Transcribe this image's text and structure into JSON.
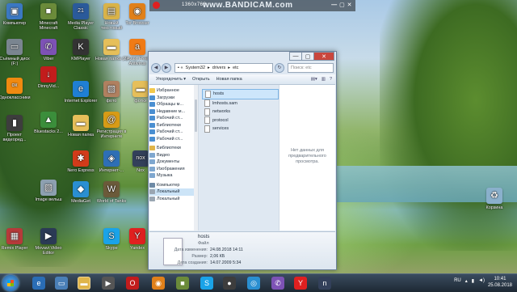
{
  "recorder": {
    "resolution": "1360x768",
    "brand": "www.BANDICAM.com"
  },
  "desktop_icons": [
    {
      "label": "Компьютер",
      "icon": "computer-icon",
      "color": "#3b78c2",
      "glyph": "▣"
    },
    {
      "label": "Minecraft Minecraft",
      "icon": "minecraft-icon",
      "color": "#6b8b3a",
      "glyph": "■"
    },
    {
      "label": "Media Player Classic",
      "icon": "media-player-icon",
      "color": "#2a5a9a",
      "glyph": "21"
    },
    {
      "label": "Новый текстовый",
      "icon": "text-document-icon",
      "color": "#d9b34a",
      "glyph": "▤"
    },
    {
      "label": "Tor Browser",
      "icon": "tor-browser-icon",
      "color": "#e0801a",
      "glyph": "◉"
    },
    {
      "label": "Съёмный диск (F:)",
      "icon": "removable-disk-icon",
      "color": "#7a8590",
      "glyph": "▭"
    },
    {
      "label": "Viber",
      "icon": "viber-icon",
      "color": "#7d52b5",
      "glyph": "✆"
    },
    {
      "label": "KMPlayer",
      "icon": "kmplayer-icon",
      "color": "#333",
      "glyph": "K"
    },
    {
      "label": "Новая папка (2)",
      "icon": "folder-icon",
      "color": "#e6bf5a",
      "glyph": "▬"
    },
    {
      "label": "Avast Free Antivirus",
      "icon": "avast-icon",
      "color": "#f07b16",
      "glyph": "a"
    },
    {
      "label": "Одноклассники",
      "icon": "odnoklassniki-icon",
      "color": "#f08a10",
      "glyph": "ок"
    },
    {
      "label": "DinnyVid...",
      "icon": "downloader-icon",
      "color": "#c21c1c",
      "glyph": "↓"
    },
    {
      "label": "Internet Explorer",
      "icon": "internet-explorer-icon",
      "color": "#1f7fd4",
      "glyph": "e"
    },
    {
      "label": "фото",
      "icon": "photo-icon",
      "color": "#b08060",
      "glyph": "▧"
    },
    {
      "label": "фотки",
      "icon": "folder-icon",
      "color": "#e6bf5a",
      "glyph": "▬"
    },
    {
      "label": "Bluestacks 2...",
      "icon": "bluestacks-icon",
      "color": "#3b8e3b",
      "glyph": "▲"
    },
    {
      "label": "Проект видеоред...",
      "icon": "video-project-icon",
      "color": "#3d3d3d",
      "glyph": "▮"
    },
    {
      "label": "Новая папка",
      "icon": "folder-icon",
      "color": "#e6bf5a",
      "glyph": "▬"
    },
    {
      "label": "Регистрация в Интернете",
      "icon": "registration-icon",
      "color": "#d79b16",
      "glyph": "@"
    },
    {
      "label": "Nero Express",
      "icon": "nero-icon",
      "color": "#d23b1a",
      "glyph": "✱"
    },
    {
      "label": "Интернет-...",
      "icon": "internet-icon",
      "color": "#2e6fb5",
      "glyph": "◈"
    },
    {
      "label": "Nox",
      "icon": "nox-icon",
      "color": "#33405a",
      "glyph": "nox"
    },
    {
      "label": "MediaGet",
      "icon": "mediaget-icon",
      "color": "#2a8fd1",
      "glyph": "◆"
    },
    {
      "label": "World of Tanks",
      "icon": "world-of-tanks-icon",
      "color": "#6b5a3a",
      "glyph": "W"
    },
    {
      "label": "Image вельш",
      "icon": "image-icon",
      "color": "#8da0b0",
      "glyph": "▧"
    },
    {
      "label": "Корзина",
      "icon": "recycle-bin-icon",
      "color": "#8ab0cc",
      "glyph": "♻"
    },
    {
      "label": "Remix Player",
      "icon": "remix-icon",
      "color": "#b53a3a",
      "glyph": "▦"
    },
    {
      "label": "Movavi Video Editor",
      "icon": "movavi-icon",
      "color": "#2b3a55",
      "glyph": "▶"
    },
    {
      "label": "Skype",
      "icon": "skype-icon",
      "color": "#1aa3e8",
      "glyph": "S"
    },
    {
      "label": "Yandex",
      "icon": "yandex-icon",
      "color": "#e02020",
      "glyph": "Y"
    }
  ],
  "explorer": {
    "path": [
      "System32",
      "drivers",
      "etc"
    ],
    "search_placeholder": "Поиск: etc",
    "toolbar": {
      "organize": "Упорядочить ▾",
      "open": "Открыть",
      "new_folder": "Новая папка"
    },
    "nav": {
      "favorites_header": "Избранное",
      "favorites": [
        "Загрузки",
        "Образцы м...",
        "Недавние м...",
        "Рабочий ст...",
        "Библиотеки",
        "Рабочий ст...",
        "Рабочий ст..."
      ],
      "libraries_header": "Библиотеки",
      "libraries": [
        "Видео",
        "Документы",
        "Изображения",
        "Музыка"
      ],
      "computer_header": "Компьютер",
      "drives": [
        "Локальный",
        "Локальный"
      ]
    },
    "files": [
      "hosts",
      "lmhosts.sam",
      "networks",
      "protocol",
      "services"
    ],
    "selected_file": "hosts",
    "preview_text": "Нет данных для предварительного просмотра.",
    "details": {
      "name": "hosts",
      "type": "Файл",
      "modified_label": "Дата изменения:",
      "modified": "24.08.2018 14:11",
      "size_label": "Размер:",
      "size": "2,06 КБ",
      "created_label": "Дата создания:",
      "created": "14.07.2009 5:34"
    }
  },
  "taskbar": {
    "language": "RU",
    "time": "10:41",
    "date": "25.08.2018"
  }
}
